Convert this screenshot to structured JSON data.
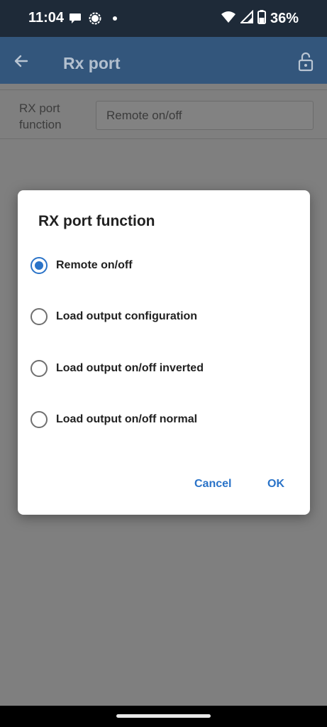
{
  "status_bar": {
    "time": "11:04",
    "battery": "36%",
    "icons": [
      "chat-bubble-icon",
      "signal-messenger-icon",
      "dot-icon",
      "wifi-icon",
      "cell-signal-icon",
      "battery-icon"
    ]
  },
  "app_bar": {
    "title": "Rx port",
    "icons": [
      "back-arrow-icon",
      "lock-icon"
    ]
  },
  "content": {
    "field_label": "RX port\nfunction",
    "field_value": "Remote on/off"
  },
  "dialog": {
    "title": "RX port function",
    "options": [
      {
        "label": "Remote on/off",
        "selected": true
      },
      {
        "label": "Load output configuration",
        "selected": false
      },
      {
        "label": "Load output on/off inverted",
        "selected": false
      },
      {
        "label": "Load output on/off normal",
        "selected": false
      }
    ],
    "cancel_label": "Cancel",
    "ok_label": "OK"
  },
  "colors": {
    "accent": "#2a73c8",
    "app_bar": "#33567c",
    "status_bar": "#1e2a38"
  }
}
